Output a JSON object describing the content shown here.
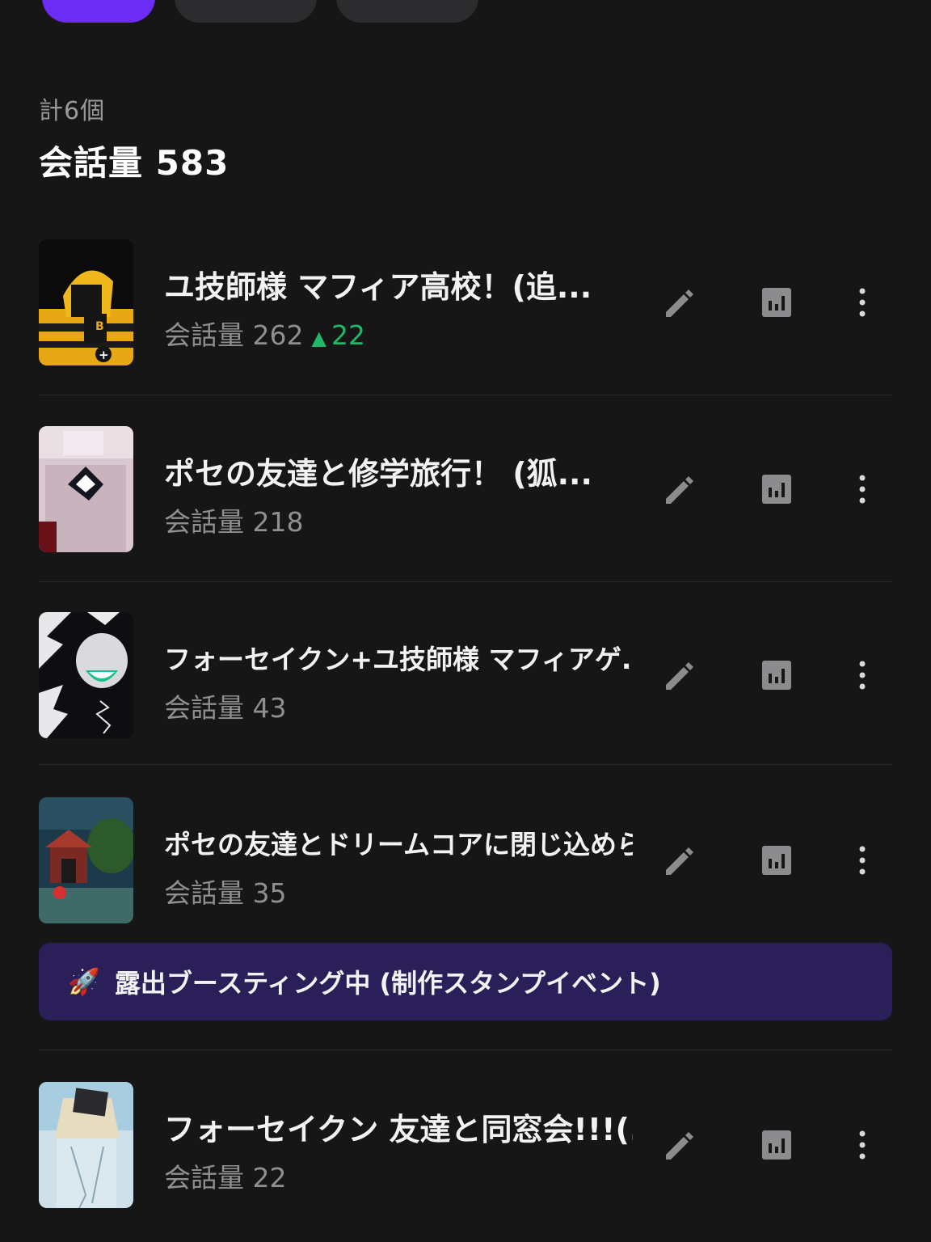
{
  "summary": {
    "count_label": "計6個",
    "total_label": "会話量 583"
  },
  "items": [
    {
      "title": "ユ技師様 マフィア高校！(追...",
      "metric_label": "会話量",
      "metric_value": "262",
      "delta": "22"
    },
    {
      "title": "ポセの友達と修学旅行！ (狐...",
      "metric_label": "会話量",
      "metric_value": "218"
    },
    {
      "title": "フォーセイクン+ユ技師様 マフィアゲ...",
      "metric_label": "会話量",
      "metric_value": "43"
    },
    {
      "title": "ポセの友達とドリームコアに閉じ込めら...",
      "metric_label": "会話量",
      "metric_value": "35"
    },
    {
      "title": "フォーセイクン 友達と同窓会!!!(...",
      "metric_label": "会話量",
      "metric_value": "22"
    }
  ],
  "boost_banner": {
    "icon": "rocket-icon",
    "text": "露出ブースティング中 (制作スタンプイベント)"
  },
  "icons": {
    "edit": "pencil-icon",
    "stats": "bar-chart-icon",
    "more": "more-vertical-icon"
  },
  "colors": {
    "accent": "#6b2df5",
    "delta_up": "#1eb868",
    "banner_bg": "#2b1f59"
  }
}
